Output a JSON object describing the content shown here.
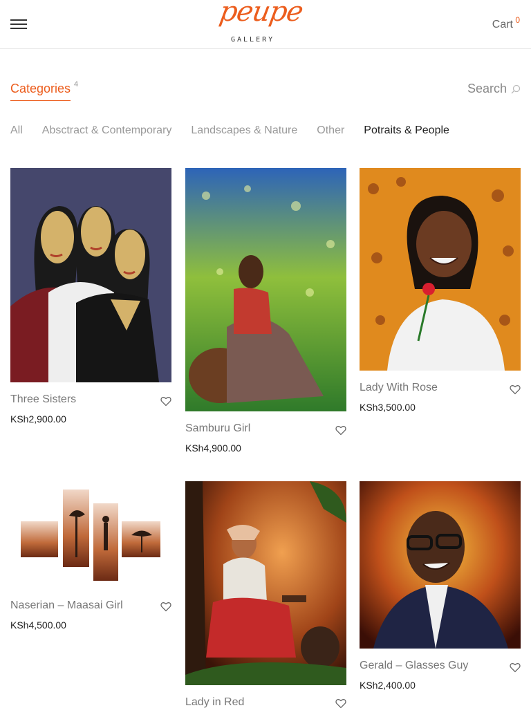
{
  "header": {
    "logo_script": "peupe",
    "logo_sub": "GALLERY",
    "cart_label": "Cart",
    "cart_count": "0",
    "accent": "#ec5d1d"
  },
  "categories": {
    "toggle_label": "Categories",
    "count": "4",
    "search_label": "Search",
    "filters": [
      "All",
      "Absctract & Contemporary",
      "Landscapes & Nature",
      "Other",
      "Potraits & People"
    ],
    "active_filter": "Potraits & People"
  },
  "products": [
    {
      "title": "Three Sisters",
      "price": "KSh2,900.00",
      "icon": "heart-icon"
    },
    {
      "title": "Samburu Girl",
      "price": "KSh4,900.00",
      "icon": "heart-icon"
    },
    {
      "title": "Lady With Rose",
      "price": "KSh3,500.00",
      "icon": "heart-icon"
    },
    {
      "title": "Naserian – Maasai Girl",
      "price": "KSh4,500.00",
      "icon": "heart-icon"
    },
    {
      "title": "Lady in Red",
      "price": "",
      "icon": "heart-icon"
    },
    {
      "title": "Gerald – Glasses Guy",
      "price": "KSh2,400.00",
      "icon": "heart-icon"
    }
  ]
}
